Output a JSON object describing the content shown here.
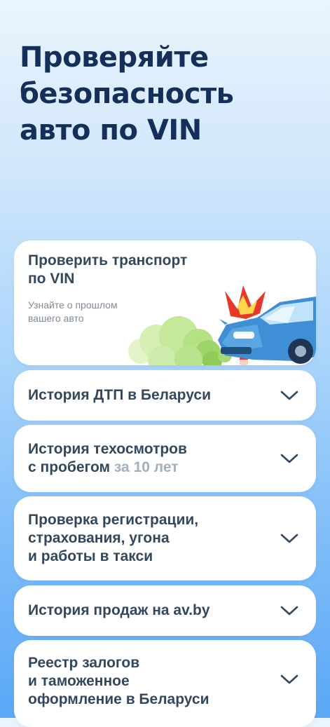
{
  "headline": {
    "lines": [
      "Проверяйте",
      "безопасность",
      "авто по VIN"
    ]
  },
  "hero": {
    "title_lines": [
      "Проверить транспорт",
      "по VIN"
    ],
    "subtitle_lines": [
      "Узнайте о прошлом",
      "вашего авто"
    ],
    "illustration": "car-crash-illustration"
  },
  "items": [
    {
      "lines": [
        "История ДТП в Беларуси"
      ]
    },
    {
      "lines": [
        "История техосмотров"
      ],
      "line2": "с пробегом",
      "muted": " за 10 лет"
    },
    {
      "lines": [
        "Проверка регистрации,",
        "страхования, угона",
        "и работы в такси"
      ]
    },
    {
      "lines": [
        "История продаж на av.by"
      ]
    },
    {
      "lines": [
        "Реестр залогов",
        "и таможенное",
        "оформление в Беларуси"
      ]
    }
  ],
  "icons": {
    "chevron": "chevron-down-icon"
  },
  "colors": {
    "heading": "#14305a",
    "card_text": "#33485f",
    "muted_text": "#a2b0bd",
    "subtitle": "#808a94",
    "car_blue": "#3f8fd6",
    "crash_red": "#e8372b",
    "smoke_green": "#a8dc6b"
  }
}
